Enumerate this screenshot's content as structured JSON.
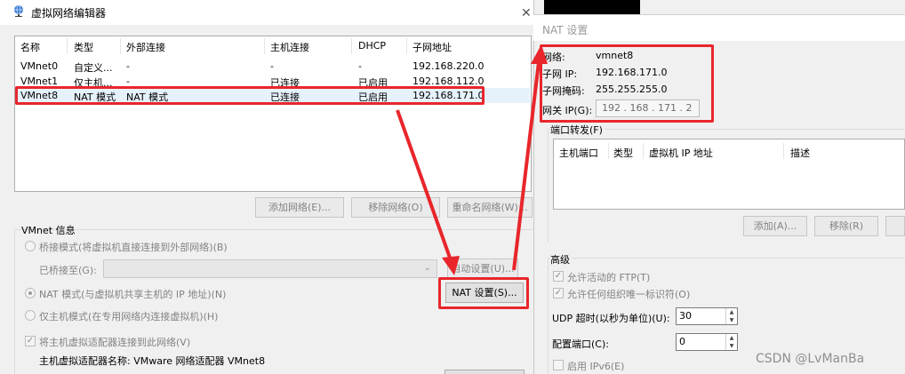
{
  "editor": {
    "title": "虚拟网络编辑器",
    "table": {
      "headers": [
        "名称",
        "类型",
        "外部连接",
        "主机连接",
        "DHCP",
        "子网地址"
      ],
      "rows": [
        [
          "VMnet0",
          "自定义...",
          "-",
          "-",
          "-",
          "192.168.220.0"
        ],
        [
          "VMnet1",
          "仅主机...",
          "-",
          "已连接",
          "已启用",
          "192.168.112.0"
        ],
        [
          "VMnet8",
          "NAT 模式",
          "NAT 模式",
          "已连接",
          "已启用",
          "192.168.171.0"
        ]
      ]
    },
    "buttons": {
      "add_network": "添加网络(E)...",
      "remove_network": "移除网络(O)",
      "rename_network": "重命名网络(W)..."
    },
    "vmnet_info": {
      "group_label": "VMnet 信息",
      "bridged_mode": "桥接模式(将虚拟机直接连接到外部网络)(B)",
      "bridged_to_label": "已桥接至(G):",
      "auto_settings": "自动设置(U)...",
      "nat_mode": "NAT 模式(与虚拟机共享主机的 IP 地址)(N)",
      "nat_settings": "NAT 设置(S)...",
      "host_only_mode": "仅主机模式(在专用网络内连接虚拟机)(H)",
      "connect_adapter": "将主机虚拟适配器连接到此网络(V)",
      "adapter_name": "主机虚拟适配器名称: VMware 网络适配器 VMnet8"
    }
  },
  "nat": {
    "title": "NAT 设置",
    "network_label": "网络:",
    "network_value": "vmnet8",
    "subnet_ip_label": "子网 IP:",
    "subnet_ip_value": "192.168.171.0",
    "subnet_mask_label": "子网掩码:",
    "subnet_mask_value": "255.255.255.0",
    "gateway_label": "网关 IP(G):",
    "gateway_value": "192 . 168 . 171 . 2",
    "port_forwarding": {
      "group_label": "端口转发(F)",
      "headers": [
        "主机端口",
        "类型",
        "虚拟机 IP 地址",
        "描述"
      ],
      "add": "添加(A)...",
      "remove": "移除(R)"
    },
    "advanced": {
      "group_label": "高级",
      "allow_active_ftp": "允许活动的 FTP(T)",
      "allow_any_oui": "允许任何组织唯一标识符(O)",
      "udp_timeout_label": "UDP 超时(以秒为单位)(U):",
      "udp_timeout_value": "30",
      "config_port_label": "配置端口(C):",
      "config_port_value": "0",
      "enable_ipv6": "启用 IPv6(E)"
    }
  },
  "watermark": "CSDN @LvManBa",
  "colors": {
    "annotation": "#e8262b",
    "selection": "#e5f1fb"
  },
  "icons": {
    "app": "globe-network-icon",
    "close": "close-icon"
  }
}
